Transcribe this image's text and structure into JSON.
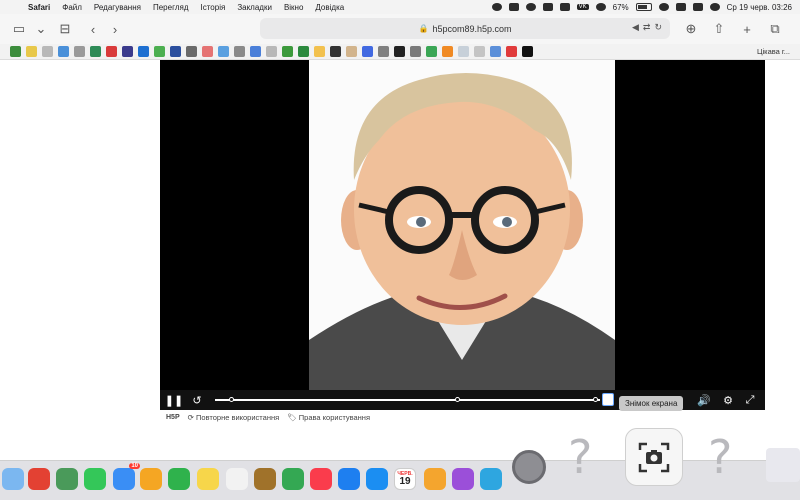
{
  "menubar": {
    "app": "Safari",
    "items": [
      "Файл",
      "Редагування",
      "Перегляд",
      "Історія",
      "Закладки",
      "Вікно",
      "Довідка"
    ],
    "vk": "VK",
    "battery": "67%",
    "datetime": "Ср 19 черв.  03:26"
  },
  "toolbar": {
    "url": "h5pcom89.h5p.com"
  },
  "favorites": {
    "last_item": "Цікава г..."
  },
  "player": {
    "footer_logo": "H5P",
    "reuse": "Повторне використання",
    "rights": "Права користування",
    "tooltip": "Знімок екрана",
    "progress_fraction": 0.99
  },
  "dock": {
    "mail_badge": "10",
    "calendar_month": "ЧЕРВ.",
    "calendar_day": "19"
  }
}
